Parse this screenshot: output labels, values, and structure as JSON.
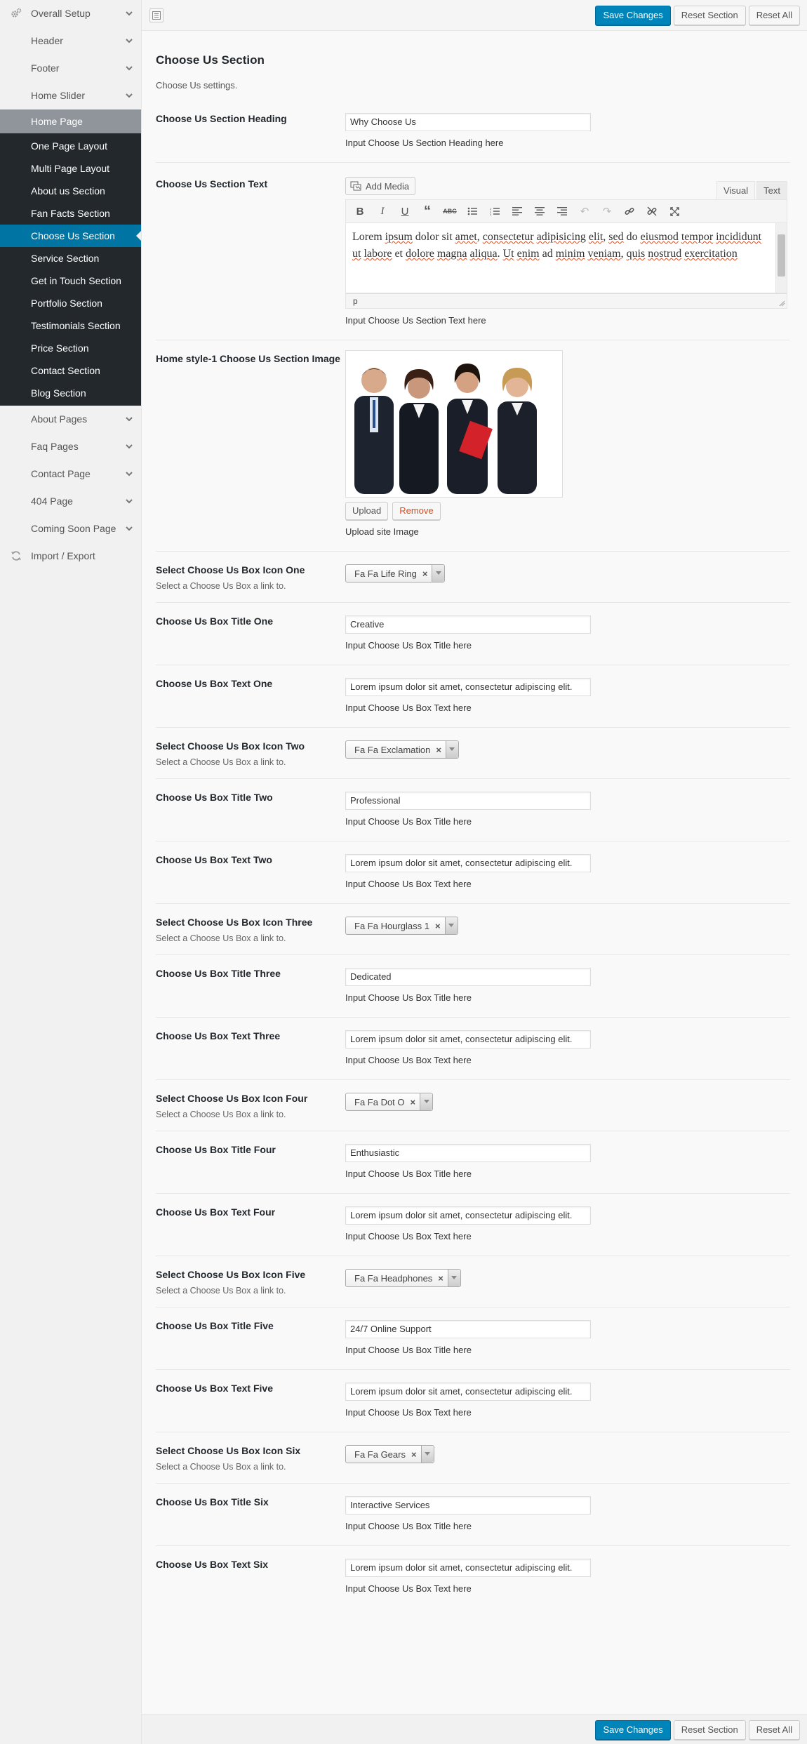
{
  "sidebar": {
    "top_items": [
      {
        "label": "Overall Setup",
        "icon": "gears-icon"
      },
      {
        "label": "Header"
      },
      {
        "label": "Footer"
      },
      {
        "label": "Home Slider"
      }
    ],
    "active_parent": "Home Page",
    "sub_items": [
      "One Page Layout",
      "Multi Page Layout",
      "About us Section",
      "Fan Facts Section",
      "Choose Us Section",
      "Service Section",
      "Get in Touch Section",
      "Portfolio Section",
      "Testimonials Section",
      "Price Section",
      "Contact Section",
      "Blog Section"
    ],
    "bottom_items": [
      {
        "label": "About Pages"
      },
      {
        "label": "Faq Pages"
      },
      {
        "label": "Contact Page"
      },
      {
        "label": "404 Page"
      },
      {
        "label": "Coming Soon Page"
      },
      {
        "label": "Import / Export",
        "icon": "refresh-icon"
      }
    ]
  },
  "toolbar": {
    "save_label": "Save Changes",
    "reset_section_label": "Reset Section",
    "reset_all_label": "Reset All"
  },
  "section": {
    "title": "Choose Us Section",
    "description": "Choose Us settings."
  },
  "heading_field": {
    "label": "Choose Us Section Heading",
    "value": "Why Choose Us",
    "help": "Input Choose Us Section Heading here"
  },
  "text_field": {
    "label": "Choose Us Section Text",
    "add_media": "Add Media",
    "tab_visual": "Visual",
    "tab_text": "Text",
    "content_words": [
      "Lorem",
      " ",
      "ipsum",
      " dolor sit ",
      "amet",
      ", ",
      "consectetur",
      " ",
      "adipisicing",
      " ",
      "elit",
      ", ",
      "sed",
      " do ",
      "eiusmod",
      " ",
      "tempor",
      " ",
      "incididunt",
      " ",
      "ut",
      " ",
      "labore",
      " et ",
      "dolore",
      " ",
      "magna",
      " ",
      "aliqua",
      ". ",
      "Ut",
      " ",
      "enim",
      " ad ",
      "minim",
      " ",
      "veniam",
      ", ",
      "quis",
      " ",
      "nostrud",
      " ",
      "exercitation"
    ],
    "status": "p",
    "help": "Input Choose Us Section Text here"
  },
  "image_field": {
    "label": "Home style-1 Choose Us Section Image",
    "upload": "Upload",
    "remove": "Remove",
    "help": "Upload site Image"
  },
  "boxes": [
    {
      "icon_label": "Select Choose Us Box Icon One",
      "icon_sub": "Select a Choose Us Box a link to.",
      "icon_value": "Fa Fa Life Ring",
      "title_label": "Choose Us Box Title One",
      "title_value": "Creative",
      "title_help": "Input Choose Us Box Title here",
      "text_label": "Choose Us Box Text One",
      "text_value": "Lorem ipsum dolor sit amet, consectetur adipiscing elit.",
      "text_help": "Input Choose Us Box Text here"
    },
    {
      "icon_label": "Select Choose Us Box Icon Two",
      "icon_sub": "Select a Choose Us Box a link to.",
      "icon_value": "Fa Fa Exclamation",
      "title_label": "Choose Us Box Title Two",
      "title_value": "Professional",
      "title_help": "Input Choose Us Box Title here",
      "text_label": "Choose Us Box Text Two",
      "text_value": "Lorem ipsum dolor sit amet, consectetur adipiscing elit.",
      "text_help": "Input Choose Us Box Text here"
    },
    {
      "icon_label": "Select Choose Us Box Icon Three",
      "icon_sub": "Select a Choose Us Box a link to.",
      "icon_value": "Fa Fa Hourglass 1",
      "title_label": "Choose Us Box Title Three",
      "title_value": "Dedicated",
      "title_help": "Input Choose Us Box Title here",
      "text_label": "Choose Us Box Text Three",
      "text_value": "Lorem ipsum dolor sit amet, consectetur adipiscing elit.",
      "text_help": "Input Choose Us Box Text here"
    },
    {
      "icon_label": "Select Choose Us Box Icon Four",
      "icon_sub": "Select a Choose Us Box a link to.",
      "icon_value": "Fa Fa Dot O",
      "title_label": "Choose Us Box Title Four",
      "title_value": "Enthusiastic",
      "title_help": "Input Choose Us Box Title here",
      "text_label": "Choose Us Box Text Four",
      "text_value": "Lorem ipsum dolor sit amet, consectetur adipiscing elit.",
      "text_help": "Input Choose Us Box Text here"
    },
    {
      "icon_label": "Select Choose Us Box Icon Five",
      "icon_sub": "Select a Choose Us Box a link to.",
      "icon_value": "Fa Fa Headphones",
      "title_label": "Choose Us Box Title Five",
      "title_value": "24/7 Online Support",
      "title_help": "Input Choose Us Box Title here",
      "text_label": "Choose Us Box Text Five",
      "text_value": "Lorem ipsum dolor sit amet, consectetur adipiscing elit.",
      "text_help": "Input Choose Us Box Text here"
    },
    {
      "icon_label": "Select Choose Us Box Icon Six",
      "icon_sub": "Select a Choose Us Box a link to.",
      "icon_value": "Fa Fa Gears",
      "title_label": "Choose Us Box Title Six",
      "title_value": "Interactive Services",
      "title_help": "Input Choose Us Box Title here",
      "text_label": "Choose Us Box Text Six",
      "text_value": "Lorem ipsum dolor sit amet, consectetur adipiscing elit.",
      "text_help": "Input Choose Us Box Text here"
    }
  ],
  "colors": {
    "primary": "#0085ba",
    "current_menu": "#0074a2",
    "submenu_bg": "#23282d",
    "remove": "#d54e21"
  }
}
